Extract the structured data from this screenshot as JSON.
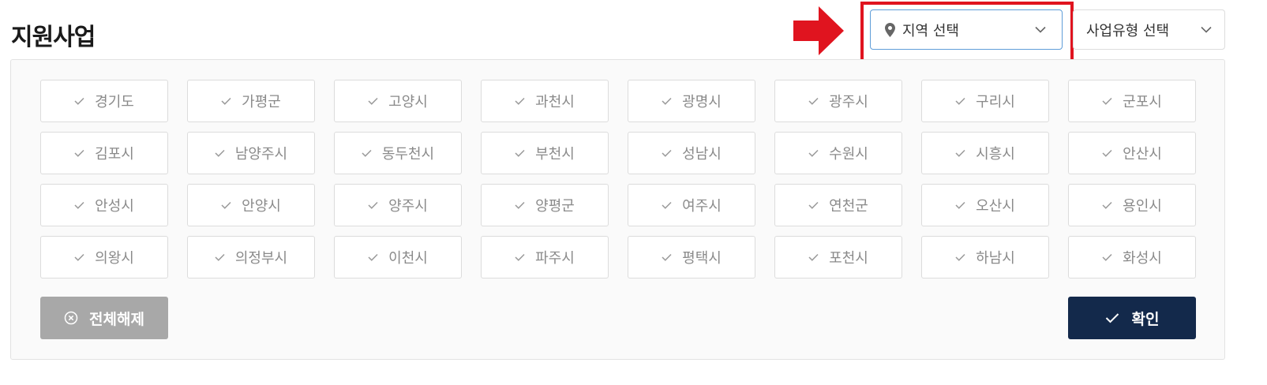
{
  "header": {
    "title": "지원사업"
  },
  "filters": {
    "region_select": {
      "label": "지역 선택",
      "icon": "map-pin-icon"
    },
    "type_select": {
      "label": "사업유형 선택",
      "icon": "chevron-down-icon"
    }
  },
  "regions": [
    "경기도",
    "가평군",
    "고양시",
    "과천시",
    "광명시",
    "광주시",
    "구리시",
    "군포시",
    "김포시",
    "남양주시",
    "동두천시",
    "부천시",
    "성남시",
    "수원시",
    "시흥시",
    "안산시",
    "안성시",
    "안양시",
    "양주시",
    "양평군",
    "여주시",
    "연천군",
    "오산시",
    "용인시",
    "의왕시",
    "의정부시",
    "이천시",
    "파주시",
    "평택시",
    "포천시",
    "하남시",
    "화성시"
  ],
  "actions": {
    "clear_all_label": "전체해제",
    "confirm_label": "확인"
  },
  "colors": {
    "annotation_red": "#e0141f",
    "confirm_bg": "#13294b",
    "clear_bg": "#a8a8a8",
    "focus_border": "#5f9dd8"
  }
}
